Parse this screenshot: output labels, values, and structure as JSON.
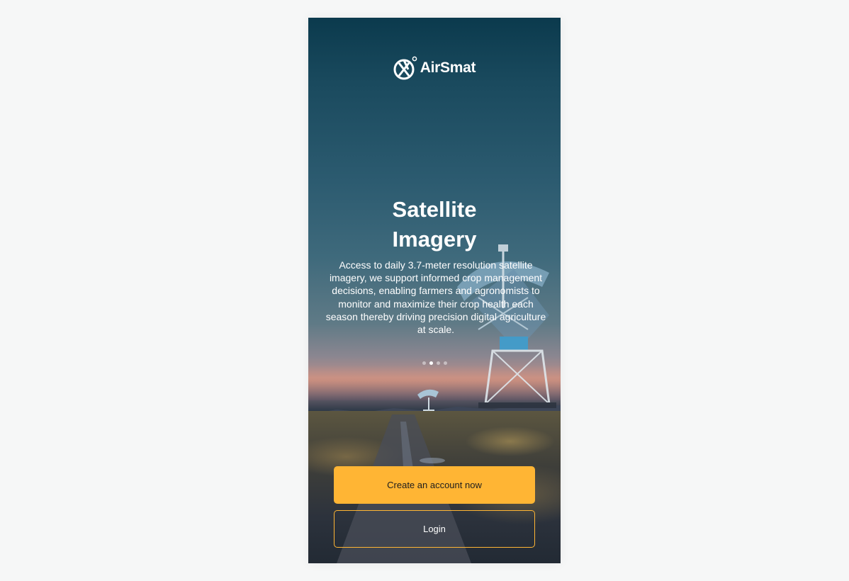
{
  "brand": {
    "name": "AirSmat",
    "logo_icon": "airsmat-logo-icon"
  },
  "slide": {
    "title": "Satellite Imagery",
    "description": "Access to daily 3.7-meter resolution satellite imagery, we support informed crop management decisions, enabling farmers and agronomists to monitor and maximize their crop health each season thereby driving precision digital agriculture at scale.",
    "total_slides": 4,
    "active_index": 1
  },
  "actions": {
    "create_account_label": "Create an account now",
    "login_label": "Login"
  },
  "colors": {
    "accent": "#ffb534",
    "text": "#ffffff",
    "page_background": "#f6f7f7"
  }
}
